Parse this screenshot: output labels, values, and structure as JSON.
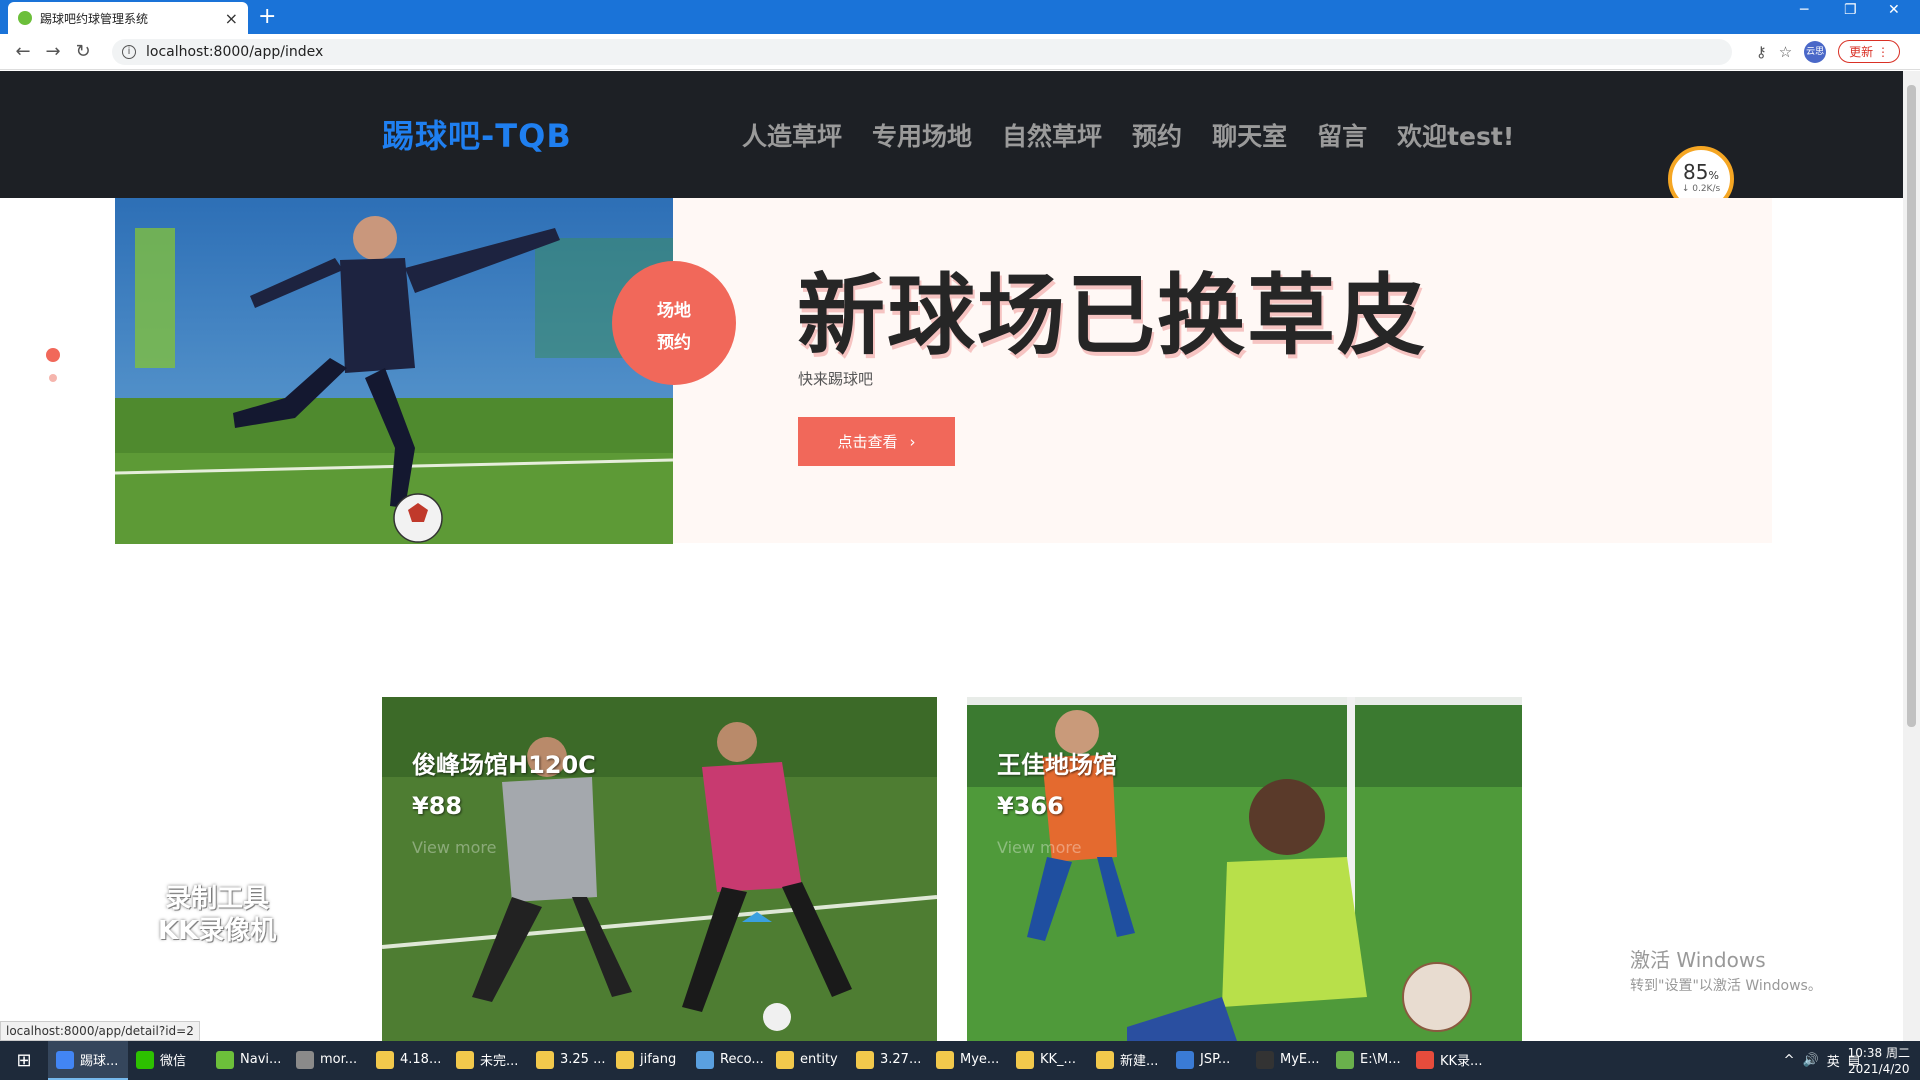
{
  "browser": {
    "tab_title": "踢球吧约球管理系统",
    "tab_close": "×",
    "new_tab": "+",
    "url": "localhost:8000/app/index",
    "update_label": "更新",
    "profile_label": "云思",
    "status_url": "localhost:8000/app/detail?id=2"
  },
  "site": {
    "logo": "踢球吧-TQB",
    "nav": [
      "人造草坪",
      "专用场地",
      "自然草坪",
      "预约",
      "聊天室",
      "留言",
      "欢迎test!"
    ]
  },
  "speed_widget": {
    "value": "85",
    "unit": "%",
    "rate": "0.2K/s"
  },
  "hero": {
    "badge_line1": "场地",
    "badge_line2": "预约",
    "title": "新球场已换草皮",
    "subtitle": "快来踢球吧",
    "button": "点击查看"
  },
  "cards": [
    {
      "name": "俊峰场馆H120C",
      "price": "¥88",
      "more": "View more"
    },
    {
      "name": "王佳地场馆",
      "price": "¥366",
      "more": "View more"
    }
  ],
  "watermark": {
    "line1": "录制工具",
    "line2": "KK录像机"
  },
  "activate": {
    "line1": "激活 Windows",
    "line2": "转到\"设置\"以激活 Windows。"
  },
  "taskbar": {
    "items": [
      "踢球...",
      "微信",
      "Navi...",
      "mor...",
      "4.18...",
      "未完...",
      "3.25 ...",
      "jifang",
      "Reco...",
      "entity",
      "3.27...",
      "Mye...",
      "KK_...",
      "新建...",
      "JSP...",
      "MyE...",
      "E:\\M...",
      "KK录..."
    ],
    "ime": "英",
    "time": "10:38 周二",
    "date": "2021/4/20"
  },
  "colors": {
    "accent": "#f1685a",
    "logo_blue": "#1f7ff0",
    "header_bg": "#1d2025"
  }
}
